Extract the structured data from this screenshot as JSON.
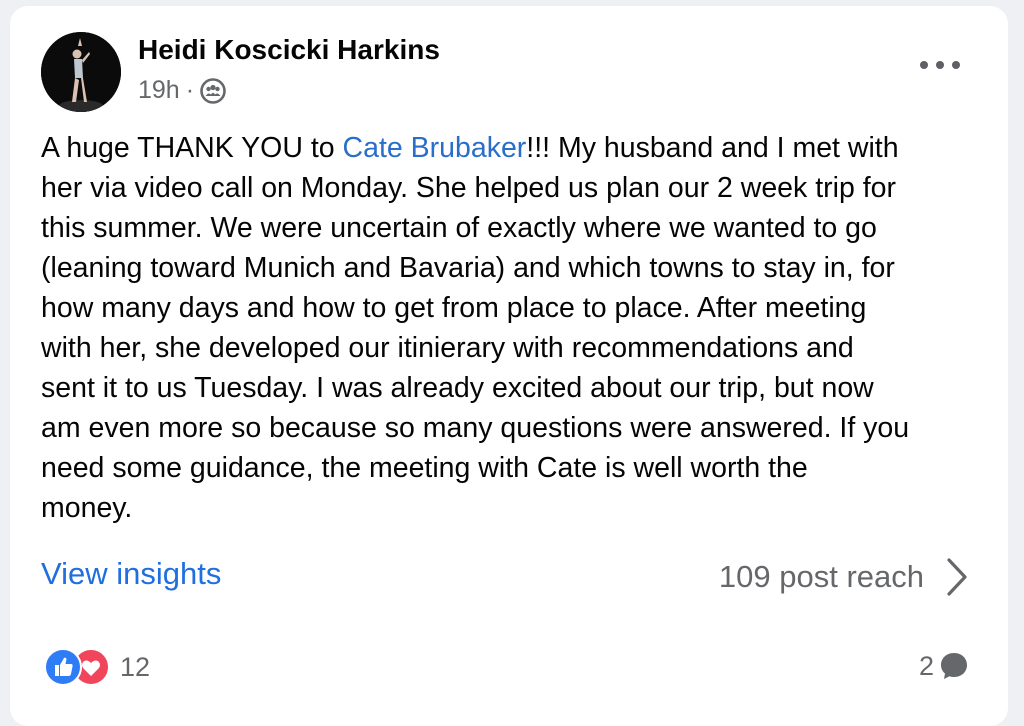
{
  "post": {
    "author": "Heidi Koscicki Harkins",
    "time": "19h",
    "separator": "·",
    "audience_icon": "group-audience-icon",
    "menu_icon": "more-options-icon",
    "body_lines": [
      {
        "before": "A huge THANK YOU to ",
        "mention": "Cate Brubaker",
        "after": "!!!  My husband and I met with"
      },
      {
        "text": "her via video call on Monday.  She helped us plan our 2 week trip for"
      },
      {
        "text": "this summer.  We were uncertain of exactly where we wanted to go"
      },
      {
        "text": "(leaning toward Munich and Bavaria) and which towns to stay in, for"
      },
      {
        "text": "how many days and how to get from place to place.  After meeting"
      },
      {
        "text": "with her, she developed our itinierary with recommendations and"
      },
      {
        "text": "sent it to us Tuesday.  I was already excited about our trip, but now"
      },
      {
        "text": "am even more so because so many questions were answered.  If you"
      },
      {
        "text": "need some guidance, the meeting with Cate is well worth the"
      },
      {
        "text": "money."
      }
    ]
  },
  "insights": {
    "link_label": "View insights",
    "reach_label": "109 post reach",
    "chevron_icon": "chevron-right-icon"
  },
  "footer": {
    "reactions_count": "12",
    "reaction_icons": [
      "like-icon",
      "love-icon"
    ],
    "comments_count": "2",
    "comment_icon": "comment-bubble-icon"
  },
  "colors": {
    "link_blue": "#1f6fe0",
    "mention_blue": "#2a6ecb",
    "secondary_text": "#65676b",
    "like_blue": "#2e7cf6",
    "love_red": "#f0455a"
  }
}
